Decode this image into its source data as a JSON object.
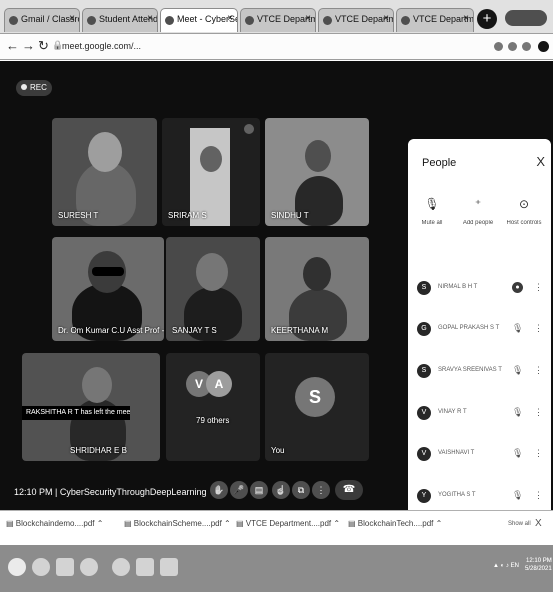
{
  "browser": {
    "tabs": [
      {
        "label": "Gmail / Classroom"
      },
      {
        "label": "Student Attendance"
      },
      {
        "label": "Meet - CyberSec"
      },
      {
        "label": "VTCE Department"
      },
      {
        "label": "VTCE Department"
      },
      {
        "label": "VTCE Department"
      }
    ],
    "new_tab": "+",
    "url": "meet.google.com/..."
  },
  "meet": {
    "recording_label": "REC",
    "tiles": [
      {
        "name": "SURESH T"
      },
      {
        "name": "SRIRAM S"
      },
      {
        "name": "SINDHU T"
      },
      {
        "name": "Dr. Om Kumar C.U Asst Prof - C..."
      },
      {
        "name": "SANJAY T S"
      },
      {
        "name": "KEERTHANA M"
      },
      {
        "name": "SHRIDHAR E B"
      },
      {
        "name": "You"
      }
    ],
    "others_avatars": [
      "V",
      "A"
    ],
    "others_label": "79 others",
    "self_avatar": "S",
    "left_banner": "RAKSHITHA R T has left the meeting",
    "time": "12:10 PM",
    "meeting_name": "CyberSecurityThroughDeepLearning",
    "controls": [
      {
        "icon": "raise-hand-icon",
        "glyph": "✋"
      },
      {
        "icon": "mic-icon",
        "glyph": "🎤"
      },
      {
        "icon": "captions-icon",
        "glyph": "▤"
      },
      {
        "icon": "hand-icon",
        "glyph": "☝"
      },
      {
        "icon": "present-icon",
        "glyph": "⧉"
      },
      {
        "icon": "more-icon",
        "glyph": "⋮"
      }
    ],
    "leave_glyph": "☎",
    "right_controls": [
      {
        "icon": "info-icon",
        "glyph": "ⓘ"
      },
      {
        "icon": "people-icon",
        "glyph": "👥"
      },
      {
        "icon": "chat-icon",
        "glyph": "▣"
      },
      {
        "icon": "activities-icon",
        "glyph": "△"
      },
      {
        "icon": "lock-icon",
        "glyph": "⊗"
      }
    ]
  },
  "people_panel": {
    "title": "People",
    "close": "X",
    "tabs": [
      {
        "label": "Mute all",
        "glyph": "🎙"
      },
      {
        "label": "Add people",
        "glyph": "⁺"
      },
      {
        "label": "Host controls",
        "glyph": "⊙"
      }
    ],
    "participants": [
      {
        "name": "NIRMAL B H T",
        "initial": "S"
      },
      {
        "name": "GOPAL PRAKASH S T",
        "initial": "G"
      },
      {
        "name": "SRAVYA SREENIVAS T",
        "initial": "S"
      },
      {
        "name": "VINAY R T",
        "initial": "V"
      },
      {
        "name": "VAISHNAVI T",
        "initial": "V"
      },
      {
        "name": "YOGITHA S T",
        "initial": "Y"
      }
    ],
    "mic_glyph": "🎙",
    "more_glyph": "⋮"
  },
  "downloads": {
    "items": [
      "Blockchaindemo....pdf",
      "BlockchainScheme....pdf",
      "VTCE Department....pdf",
      "BlockchainTech....pdf"
    ],
    "show_all": "Show all",
    "close": "X"
  },
  "taskbar": {
    "tray": "▲ ◐ ♪ EN",
    "time": "12:10 PM",
    "date": "5/28/2021"
  },
  "colors": {
    "meet_bg": "#1d1d1d",
    "panel_bg": "#ffffff",
    "taskbar_bg": "#8a8a8a"
  }
}
